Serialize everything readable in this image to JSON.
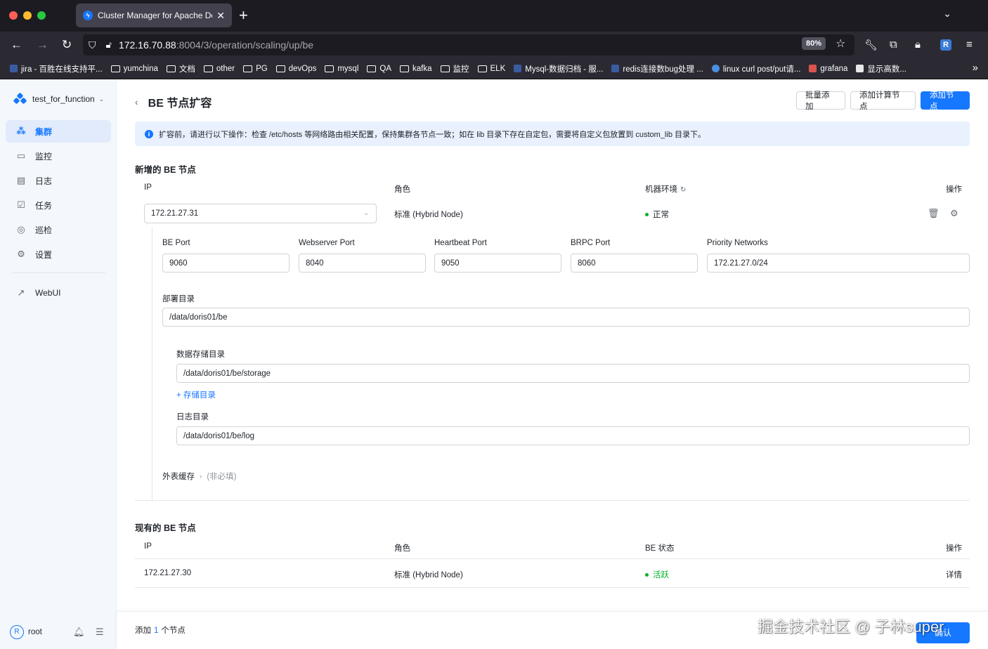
{
  "browser": {
    "tab_title": "Cluster Manager for Apache Doris",
    "url_host": "172.16.70.88",
    "url_rest": ":8004/3/operation/scaling/up/be",
    "zoom": "80%",
    "bookmarks": [
      "jira - 百胜在线支持平...",
      "yumchina",
      "文档",
      "other",
      "PG",
      "devOps",
      "mysql",
      "QA",
      "kafka",
      "监控",
      "ELK",
      "Mysql-数据归档 - 服...",
      "redis连接数bug处理 ...",
      "linux curl post/put请...",
      "grafana",
      "显示高数..."
    ]
  },
  "sidebar": {
    "cluster_name": "test_for_function",
    "items": [
      {
        "label": "集群",
        "icon": "cluster-icon",
        "active": true
      },
      {
        "label": "监控",
        "icon": "monitor-icon"
      },
      {
        "label": "日志",
        "icon": "log-icon"
      },
      {
        "label": "任务",
        "icon": "task-icon"
      },
      {
        "label": "巡检",
        "icon": "inspection-icon"
      },
      {
        "label": "设置",
        "icon": "gear-icon"
      }
    ],
    "webui": "WebUI",
    "user": "root",
    "avatar": "R"
  },
  "header": {
    "title": "BE 节点扩容",
    "batch_add": "批量添加",
    "add_compute": "添加计算节点",
    "add_node": "添加节点"
  },
  "alert": "扩容前，请进行以下操作：检查 /etc/hosts 等网络路由相关配置，保持集群各节点一致；如在 lib 目录下存在自定包，需要将自定义包放置到 custom_lib 目录下。",
  "new_nodes": {
    "title": "新增的 BE 节点",
    "columns": {
      "ip": "IP",
      "role": "角色",
      "env": "机器环境",
      "ops": "操作"
    },
    "ip": "172.21.27.31",
    "role": "标准 (Hybrid Node)",
    "env_status": "正常",
    "ports": {
      "be_port_label": "BE Port",
      "be_port": "9060",
      "webserver_label": "Webserver Port",
      "webserver": "8040",
      "heartbeat_label": "Heartbeat Port",
      "heartbeat": "9050",
      "brpc_label": "BRPC Port",
      "brpc": "8060",
      "priority_label": "Priority Networks",
      "priority": "172.21.27.0/24"
    },
    "deploy_dir_label": "部署目录",
    "deploy_dir": "/data/doris01/be",
    "storage_dir_label": "数据存储目录",
    "storage_dir": "/data/doris01/be/storage",
    "add_storage": "+ 存储目录",
    "log_dir_label": "日志目录",
    "log_dir": "/data/doris01/be/log",
    "ext_cache": "外表缓存",
    "ext_cache_optional": "(非必填)"
  },
  "existing_nodes": {
    "title": "现有的 BE 节点",
    "columns": {
      "ip": "IP",
      "role": "角色",
      "status": "BE 状态",
      "ops": "操作"
    },
    "rows": [
      {
        "ip": "172.21.27.30",
        "role": "标准 (Hybrid Node)",
        "status": "活跃",
        "ops": "详情"
      }
    ]
  },
  "footer": {
    "prefix": "添加",
    "count": "1",
    "suffix": "个节点",
    "confirm": "确认",
    "watermark": "掘金技术社区 @ 子林super"
  },
  "colors": {
    "primary": "#1677ff",
    "success": "#00b42a",
    "sidebar_bg": "#f4f7fc"
  }
}
